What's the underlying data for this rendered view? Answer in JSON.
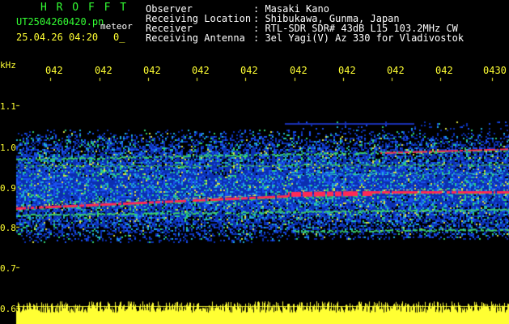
{
  "header": {
    "brand": "H R O F F T",
    "filename": "UT2504260420.pn",
    "mode": "meteor",
    "datetime": "25.04.26 04:20",
    "extra": "0_",
    "fields": [
      {
        "label": "Observer",
        "value": ": Masaki Kano"
      },
      {
        "label": "Receiving Location",
        "value": ": Shibukawa, Gunma, Japan"
      },
      {
        "label": "Receiver",
        "value": ": RTL-SDR SDR# 43dB L15 103.2MHz CW"
      },
      {
        "label": "Receiving Antenna",
        "value": ": 3el Yagi(V) Az 330 for Vladivostok"
      }
    ]
  },
  "x_ticks": [
    "042",
    "042",
    "042",
    "042",
    "042",
    "042",
    "042",
    "042",
    "042",
    "0430"
  ],
  "y_axis": {
    "unit": "kHz",
    "ticks": [
      "1.1",
      "1.0",
      "0.9",
      "0.8",
      "0.7",
      "0.6"
    ]
  },
  "colors": {
    "brand": "#33ff33",
    "axis": "#ffff33",
    "text": "#ffffff",
    "background": "#000000"
  }
}
